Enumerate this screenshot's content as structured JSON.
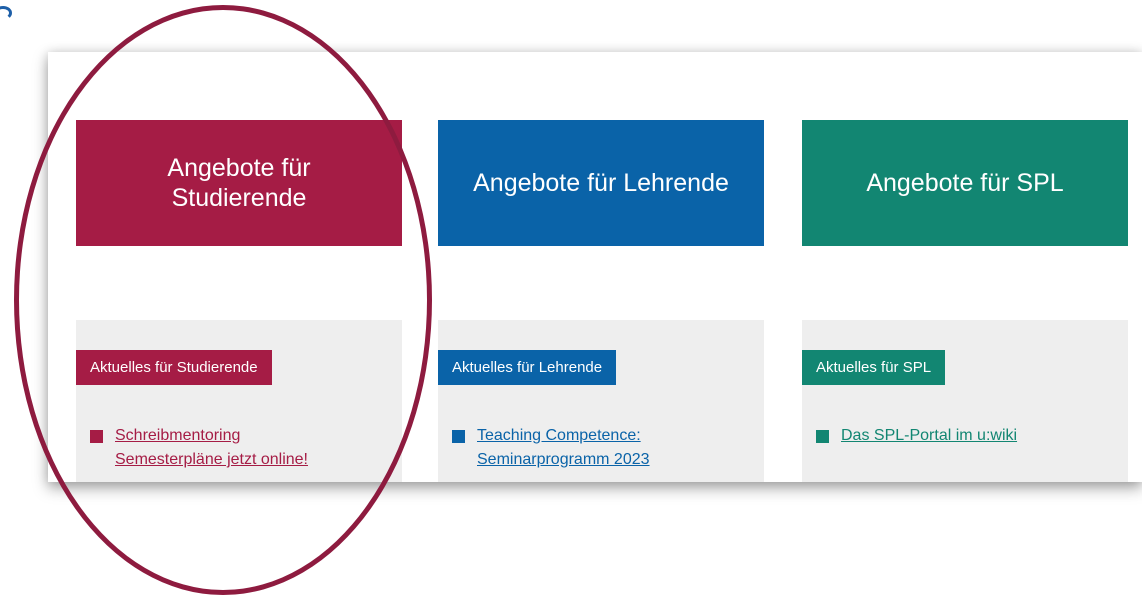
{
  "colors": {
    "students": "#a51c45",
    "teachers": "#0a63a8",
    "spl": "#128672",
    "highlight": "#8e1b3f",
    "box_bg": "#eeeeee"
  },
  "columns": [
    {
      "tile_label": "Angebote für\nStudierende",
      "tag_label": "Aktuelles für Studierende",
      "news_label": "Schreibmentoring\nSemesterpläne jetzt online!",
      "icon": "square-bullet-icon"
    },
    {
      "tile_label": "Angebote für Lehrende",
      "tag_label": "Aktuelles für Lehrende",
      "news_label": "Teaching Competence:\nSeminarprogramm 2023",
      "icon": "square-bullet-icon"
    },
    {
      "tile_label": "Angebote für SPL",
      "tag_label": "Aktuelles für SPL",
      "news_label": "Das SPL-Portal im u:wiki",
      "icon": "square-bullet-icon"
    }
  ]
}
